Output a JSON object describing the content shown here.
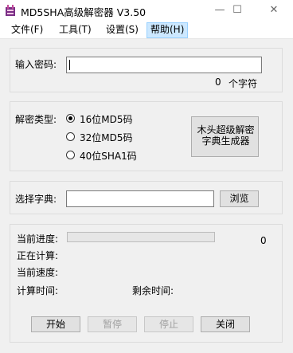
{
  "window": {
    "title": "MD5SHA高级解密器 V3.50"
  },
  "menu": [
    {
      "label": "文件(F)"
    },
    {
      "label": "工具(T)"
    },
    {
      "label": "设置(S)"
    },
    {
      "label": "帮助(H)",
      "active": true
    }
  ],
  "password": {
    "label": "输入密码:",
    "value": "",
    "count": "0",
    "count_suffix": "个字符"
  },
  "decrypt": {
    "label": "解密类型:",
    "options": [
      {
        "label": "16位MD5码",
        "selected": true
      },
      {
        "label": "32位MD5码",
        "selected": false
      },
      {
        "label": "40位SHA1码",
        "selected": false
      }
    ],
    "generator_button": "木头超级解密字典生成器"
  },
  "dictionary": {
    "label": "选择字典:",
    "value": "",
    "browse_button": "浏览"
  },
  "status": {
    "progress_label": "当前进度:",
    "progress_value": 0,
    "progress_number": "0",
    "computing_label": "正在计算:",
    "speed_label": "当前速度:",
    "elapsed_label": "计算时间:",
    "remaining_label": "剩余时间:"
  },
  "buttons": {
    "start": "开始",
    "pause": "暂停",
    "stop": "停止",
    "close": "关闭"
  },
  "colors": {
    "menu_active_bg": "#cce8ff",
    "progress_fill": "#06b025"
  }
}
